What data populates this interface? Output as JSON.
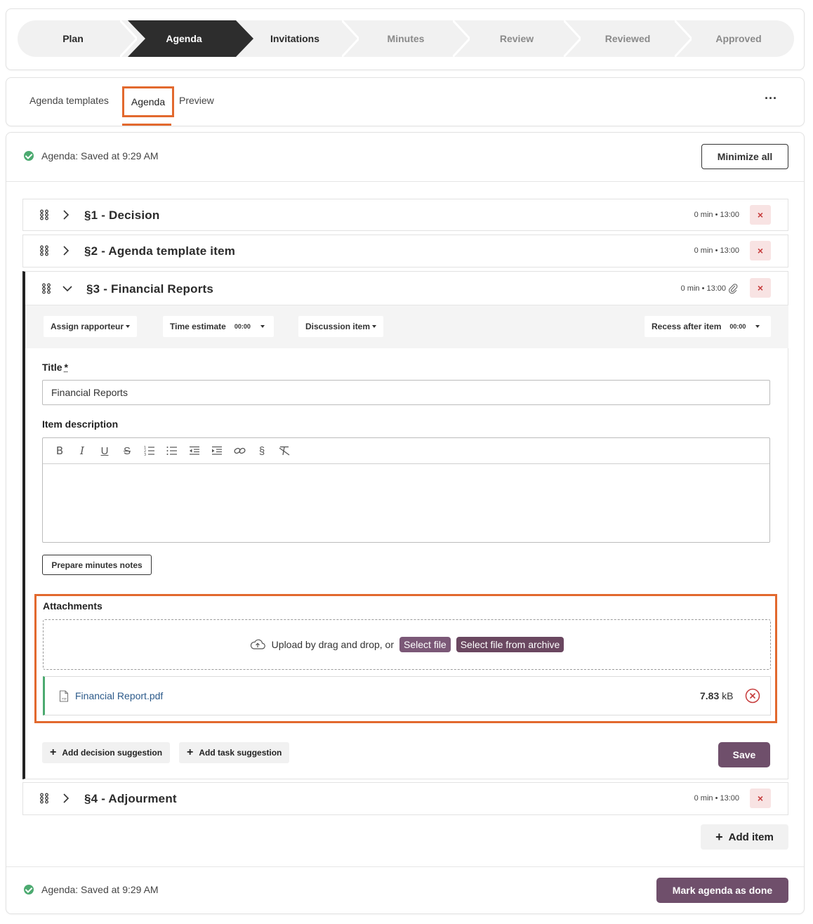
{
  "stepper": {
    "steps": [
      "Plan",
      "Agenda",
      "Invitations",
      "Minutes",
      "Review",
      "Reviewed",
      "Approved"
    ],
    "active_step": "Agenda"
  },
  "tabs": {
    "agenda_templates": "Agenda templates",
    "agenda": "Agenda",
    "preview": "Preview",
    "more": "···"
  },
  "status": {
    "saved_top": "Agenda: Saved at 9:29 AM",
    "saved_bottom": "Agenda: Saved at 9:29 AM"
  },
  "actions": {
    "minimize_all": "Minimize all",
    "add_item": "Add item",
    "mark_done": "Mark agenda as done"
  },
  "items": [
    {
      "title": "§1 - Decision",
      "meta": "0 min • 13:00",
      "delete": "×"
    },
    {
      "title": "§2 - Agenda template item",
      "meta": "0 min • 13:00",
      "delete": "×"
    },
    {
      "title": "§3 - Financial Reports",
      "meta": "0 min • 13:00",
      "delete": "×"
    },
    {
      "title": "§4 - Adjourment",
      "meta": "0 min • 13:00",
      "delete": "×"
    }
  ],
  "expanded": {
    "toolbar": {
      "assign": "Assign rapporteur",
      "time": "Time estimate",
      "time_value": "00:00",
      "discussion": "Discussion item",
      "recess": "Recess after item",
      "recess_value": "00:00"
    },
    "title_label": "Title",
    "title_required": "*",
    "title_value": "Financial Reports",
    "desc_label": "Item description",
    "editor_buttons": [
      "B",
      "I",
      "U",
      "S",
      "ordered-list",
      "bullet-list",
      "outdent",
      "indent",
      "link",
      "§",
      "clear-format"
    ],
    "prepare_notes": "Prepare minutes notes",
    "attachments_label": "Attachments",
    "upload_text": "Upload by drag and drop, or",
    "select_file": "Select file",
    "select_archive": "Select file from archive",
    "file": {
      "name": "Financial Report.pdf",
      "size": "7.83",
      "unit": "kB"
    },
    "add_decision": "Add decision suggestion",
    "add_task": "Add task suggestion",
    "save": "Save"
  },
  "colors": {
    "accent_purple": "#6f4f6b",
    "highlight_orange": "#e2692e",
    "success_green": "#4caa70",
    "danger_red": "#c63b3b"
  }
}
